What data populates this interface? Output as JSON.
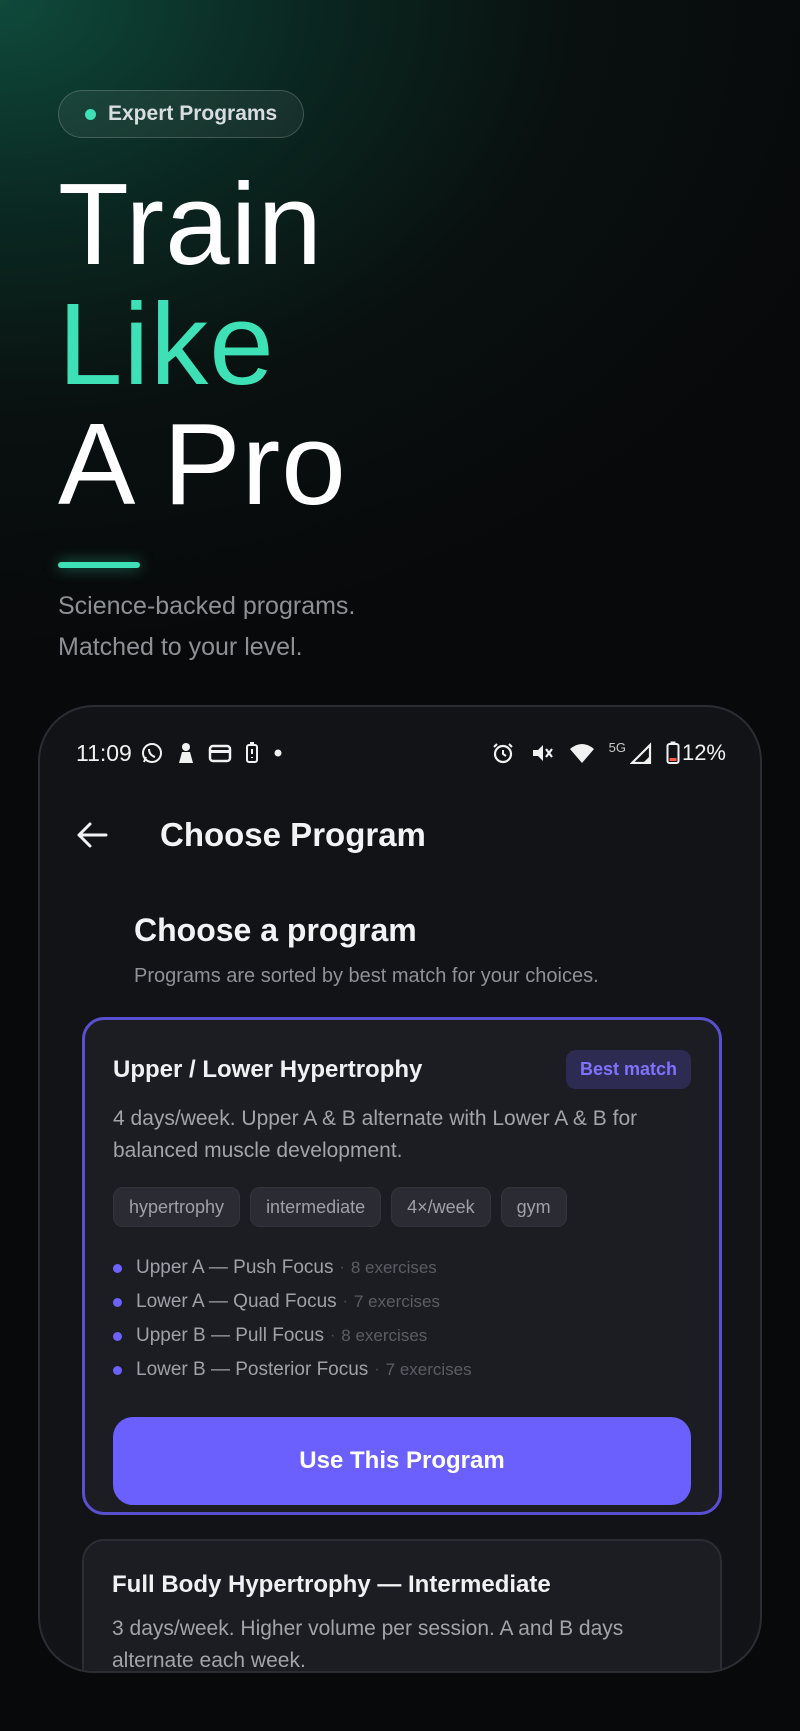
{
  "hero": {
    "pill_label": "Expert Programs",
    "headline_line1": "Train",
    "headline_line2": "Like",
    "headline_line3": "A Pro",
    "subtitle_line1": "Science-backed programs.",
    "subtitle_line2": "Matched to your level."
  },
  "statusbar": {
    "time": "11:09",
    "network": "5G",
    "battery": "12%",
    "left_icons": [
      "whatsapp-icon",
      "person-icon",
      "wallet-icon",
      "battery-saver-icon",
      "dot-icon"
    ],
    "right_icons": [
      "alarm-icon",
      "vibrate-off-icon",
      "wifi-icon",
      "signal-icon",
      "battery-icon"
    ]
  },
  "appbar": {
    "title": "Choose Program"
  },
  "section": {
    "heading": "Choose a program",
    "description": "Programs are sorted by best match for your choices."
  },
  "programs": [
    {
      "title": "Upper / Lower Hypertrophy",
      "badge": "Best match",
      "description": "4 days/week. Upper A & B alternate with Lower A & B for balanced muscle development.",
      "tags": [
        "hypertrophy",
        "intermediate",
        "4×/week",
        "gym"
      ],
      "sessions": [
        {
          "name": "Upper A — Push Focus",
          "exercises": "8 exercises"
        },
        {
          "name": "Lower A — Quad Focus",
          "exercises": "7 exercises"
        },
        {
          "name": "Upper B — Pull Focus",
          "exercises": "8 exercises"
        },
        {
          "name": "Lower B — Posterior Focus",
          "exercises": "7 exercises"
        }
      ],
      "cta": "Use This Program"
    },
    {
      "title": "Full Body Hypertrophy — Intermediate",
      "description": "3 days/week. Higher volume per session. A and B days alternate each week."
    }
  ],
  "colors": {
    "accent_green": "#3ee0b5",
    "accent_purple": "#6b5ffe",
    "card_border": "#5b4fd1",
    "badge_text": "#7f72ff"
  }
}
